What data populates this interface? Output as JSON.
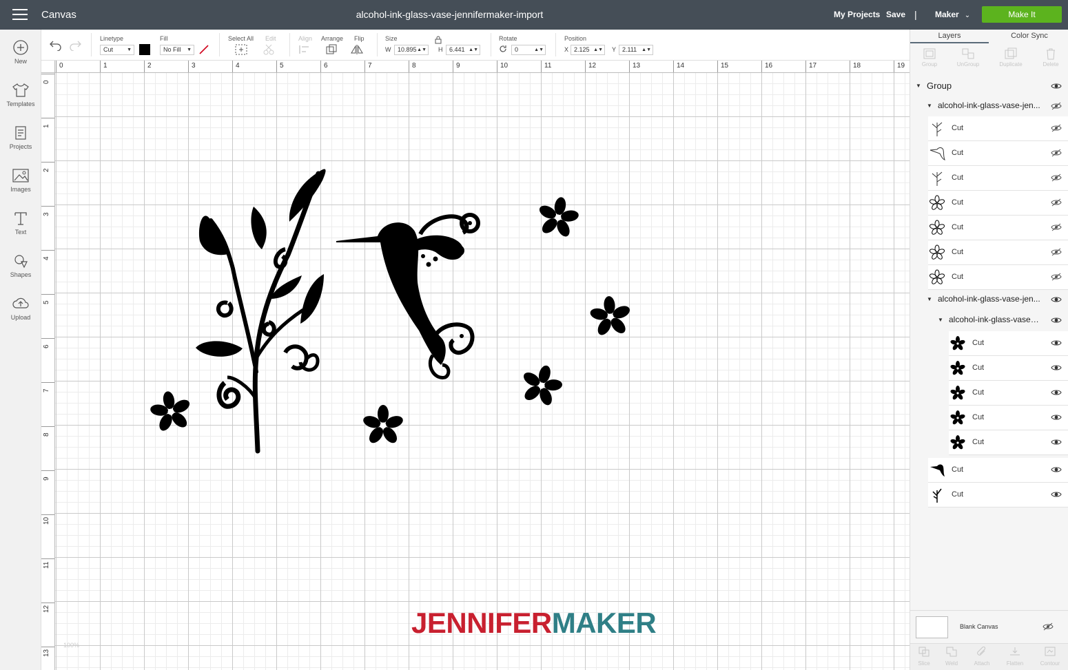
{
  "topbar": {
    "canvas_label": "Canvas",
    "file_title": "alcohol-ink-glass-vase-jennifermaker-import",
    "my_projects": "My Projects",
    "save": "Save",
    "separator": "|",
    "machine": "Maker",
    "make_it": "Make It",
    "colors": {
      "bar": "#454e57",
      "make_it": "#5cb31e"
    }
  },
  "leftbar": {
    "items": [
      {
        "label": "New",
        "icon": "plus-circle-icon"
      },
      {
        "label": "Templates",
        "icon": "tshirt-icon"
      },
      {
        "label": "Projects",
        "icon": "projects-icon"
      },
      {
        "label": "Images",
        "icon": "image-icon"
      },
      {
        "label": "Text",
        "icon": "text-icon"
      },
      {
        "label": "Shapes",
        "icon": "shapes-icon"
      },
      {
        "label": "Upload",
        "icon": "upload-cloud-icon"
      }
    ]
  },
  "toolbar": {
    "linetype_label": "Linetype",
    "linetype_value": "Cut",
    "fill_label": "Fill",
    "fill_value": "No Fill",
    "select_all_label": "Select All",
    "edit_label": "Edit",
    "align_label": "Align",
    "arrange_label": "Arrange",
    "flip_label": "Flip",
    "size_label": "Size",
    "w_label": "W",
    "w_value": "10.895",
    "h_label": "H",
    "h_value": "6.441",
    "rotate_label": "Rotate",
    "rotate_value": "0",
    "position_label": "Position",
    "x_label": "X",
    "x_value": "2.125",
    "y_label": "Y",
    "y_value": "2.111"
  },
  "rulers": {
    "horizontal": [
      "0",
      "1",
      "2",
      "3",
      "4",
      "5",
      "6",
      "7",
      "8",
      "9",
      "10",
      "11",
      "12",
      "13",
      "14",
      "15",
      "16",
      "17",
      "18",
      "19"
    ],
    "vertical": [
      "0",
      "1",
      "2",
      "3",
      "4",
      "5",
      "6",
      "7",
      "8",
      "9",
      "10",
      "11",
      "12",
      "13"
    ]
  },
  "canvas": {
    "zoom": "100%",
    "watermark_part1": "JENNIFER",
    "watermark_part2": "MAKER"
  },
  "panel": {
    "tab_layers": "Layers",
    "tab_color_sync": "Color Sync",
    "actions": [
      "Group",
      "UnGroup",
      "Duplicate",
      "Delete"
    ],
    "group_label": "Group",
    "subgroup1": "alcohol-ink-glass-vase-jen...",
    "subgroup1_items": [
      "Cut",
      "Cut",
      "Cut",
      "Cut",
      "Cut",
      "Cut",
      "Cut"
    ],
    "subgroup2": "alcohol-ink-glass-vase-jen...",
    "subgroup2_child": "alcohol-ink-glass-vase-j...",
    "subgroup2_child_items": [
      "Cut",
      "Cut",
      "Cut",
      "Cut",
      "Cut"
    ],
    "subgroup2_items": [
      "Cut",
      "Cut"
    ],
    "blank_canvas": "Blank Canvas",
    "bottom_actions": [
      "Slice",
      "Weld",
      "Attach",
      "Flatten",
      "Contour"
    ]
  }
}
